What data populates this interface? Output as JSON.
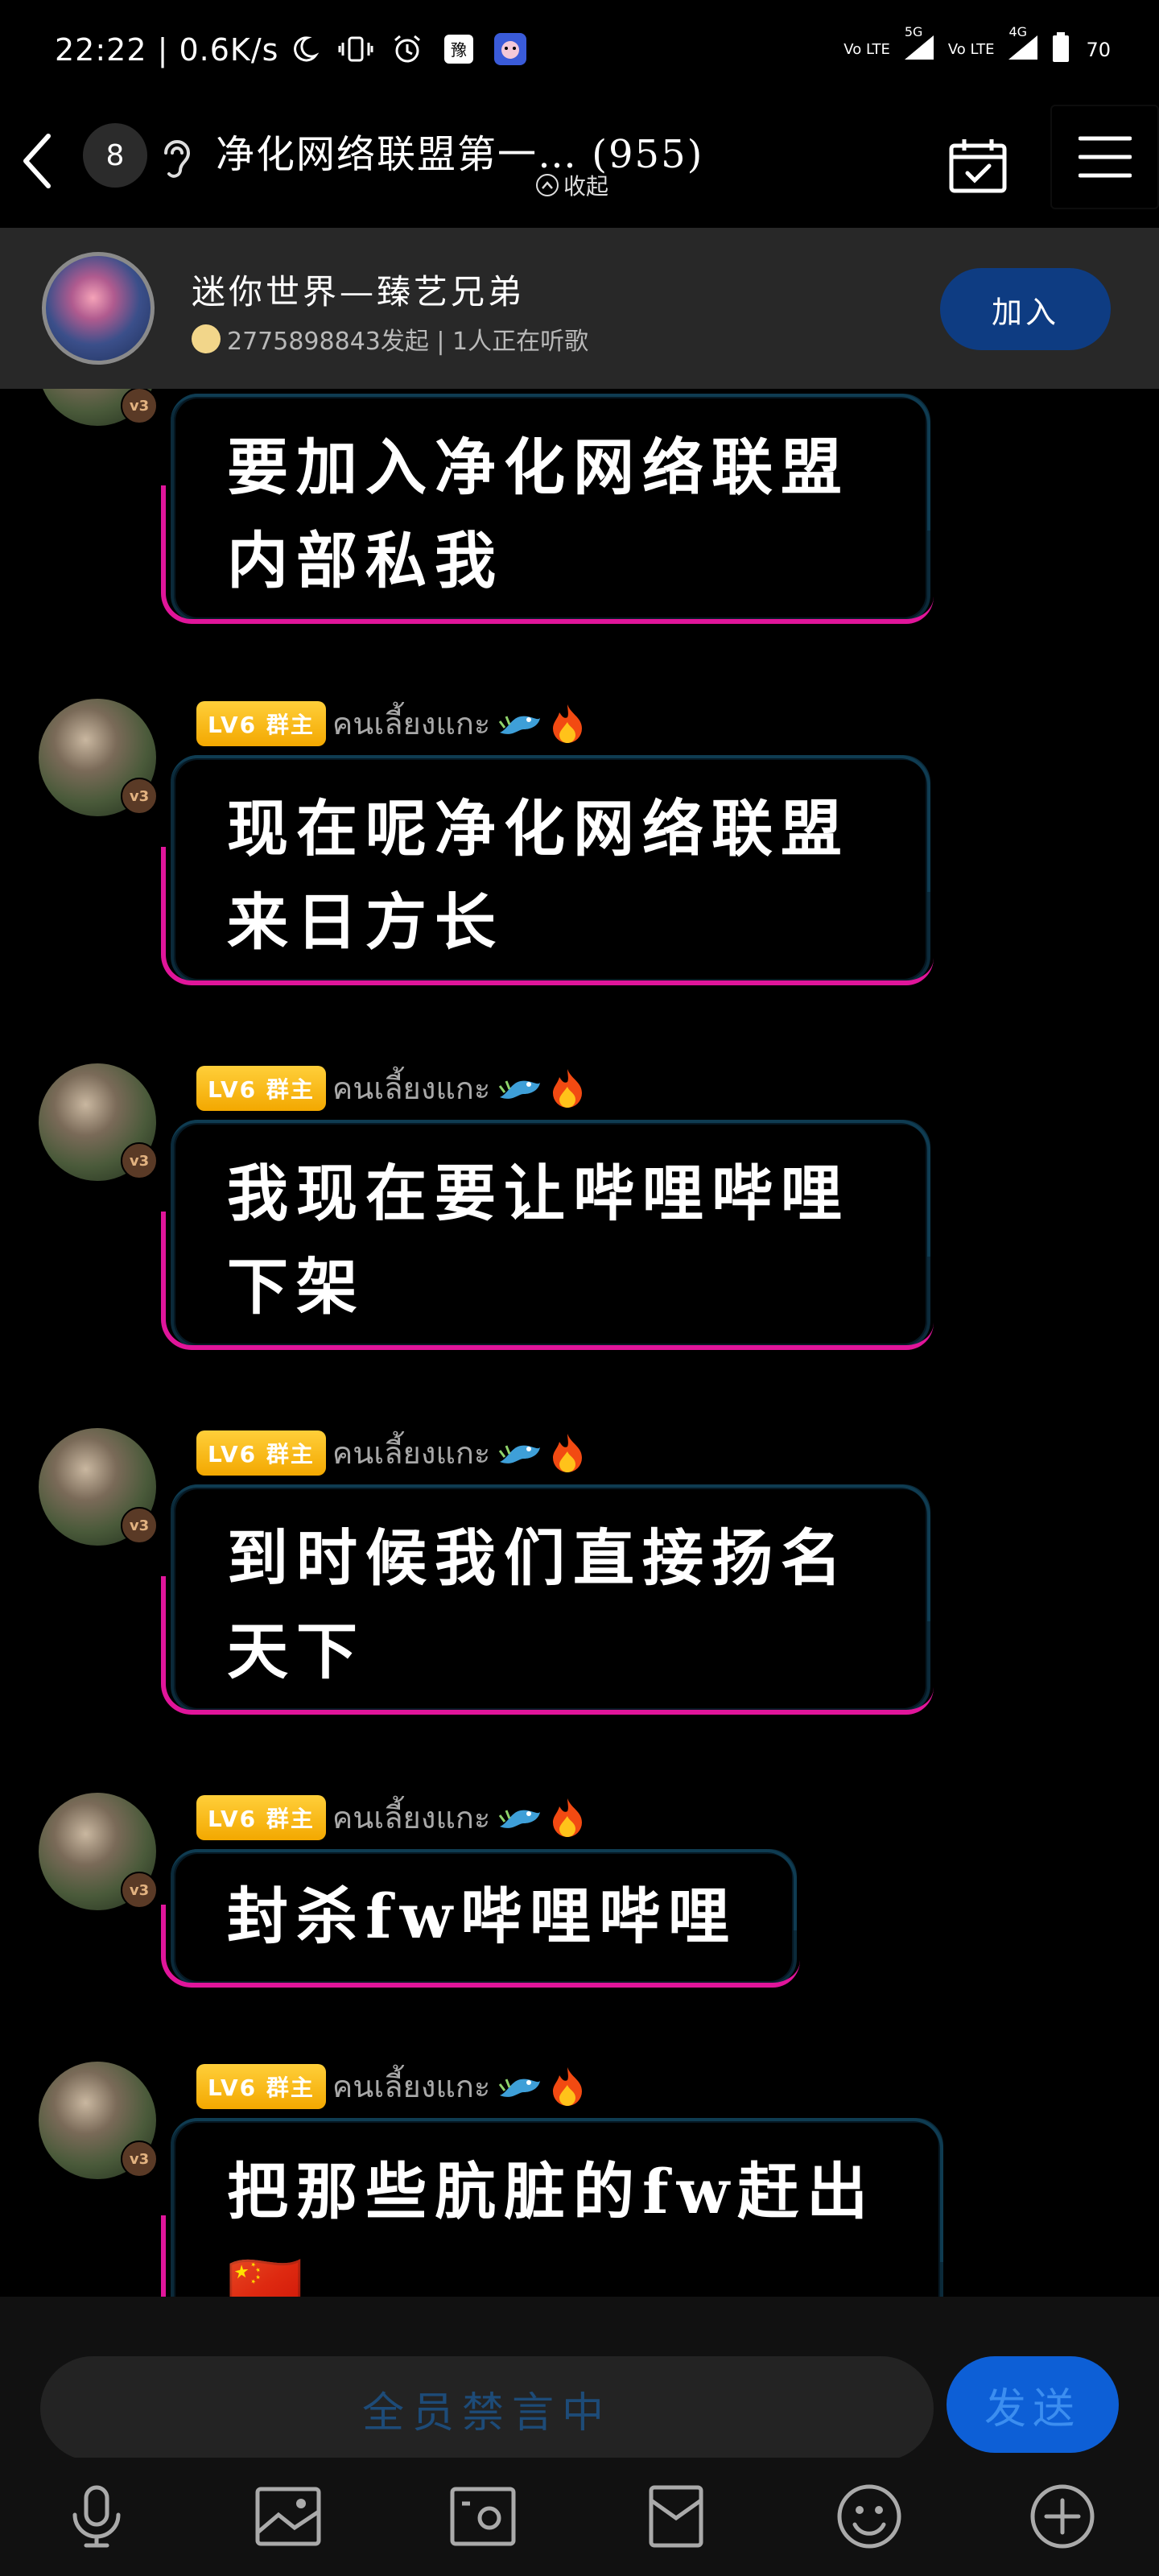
{
  "status_bar": {
    "time": "22:22 | 0.6K/s",
    "sim1_label": "Vo LTE",
    "sim1_net": "5G",
    "sim2_label": "Vo LTE",
    "sim2_net": "4G",
    "battery": "70"
  },
  "header": {
    "unread_count": "8",
    "title": "净化网络联盟第一… (955)",
    "collapse_label": "收起"
  },
  "music_banner": {
    "title": "迷你世界—臻艺兄弟",
    "subtitle": "2775898843发起 | 1人正在听歌",
    "join_label": "加入"
  },
  "messages": [
    {
      "level": "",
      "sender": "",
      "text": "要加入净化网络联盟\n内部私我"
    },
    {
      "level": "LV6 群主",
      "sender": "คนเลี้ยงแกะ",
      "text": "现在呢净化网络联盟\n来日方长"
    },
    {
      "level": "LV6 群主",
      "sender": "คนเลี้ยงแกะ",
      "text": "我现在要让哔哩哔哩\n下架"
    },
    {
      "level": "LV6 群主",
      "sender": "คนเลี้ยงแกะ",
      "text": "到时候我们直接扬名\n天下"
    },
    {
      "level": "LV6 群主",
      "sender": "คนเลี้ยงแกะ",
      "text": "封杀fw哔哩哔哩"
    },
    {
      "level": "LV6 群主",
      "sender": "คนเลี้ยงแกะ",
      "text": "把那些肮脏的fw赶出\n🇨🇳"
    }
  ],
  "avatar_badge": "v3",
  "input": {
    "placeholder": "全员禁言中",
    "send_label": "发送"
  },
  "colors": {
    "bubble_glow_pink": "#e0159a",
    "bubble_glow_blue": "#0f3c52",
    "level_tag": "#f3a800",
    "join_button": "#0e3c82",
    "send_button": "#0d5fd6"
  },
  "icons": [
    "back-icon",
    "ear-icon",
    "calendar-check-icon",
    "menu-icon",
    "microphone-icon",
    "image-icon",
    "camera-icon",
    "red-packet-icon",
    "emoji-icon",
    "plus-icon"
  ]
}
